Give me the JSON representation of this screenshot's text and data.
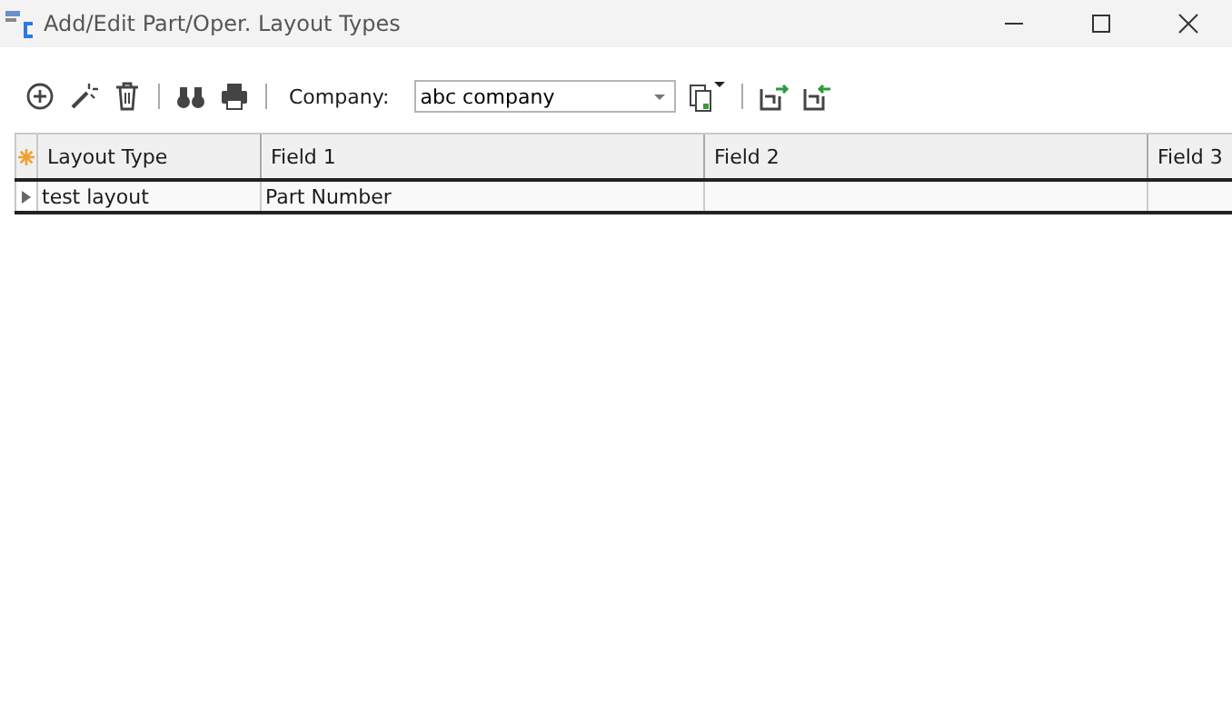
{
  "window": {
    "title": "Add/Edit Part/Oper. Layout Types"
  },
  "toolbar": {
    "company_label": "Company:",
    "company": {
      "value": "abc company"
    }
  },
  "table": {
    "columns": [
      "Layout Type",
      "Field 1",
      "Field 2",
      "Field 3"
    ],
    "rows": [
      {
        "cells": [
          "test layout",
          "Part Number",
          "",
          ""
        ],
        "selected": true
      }
    ]
  }
}
